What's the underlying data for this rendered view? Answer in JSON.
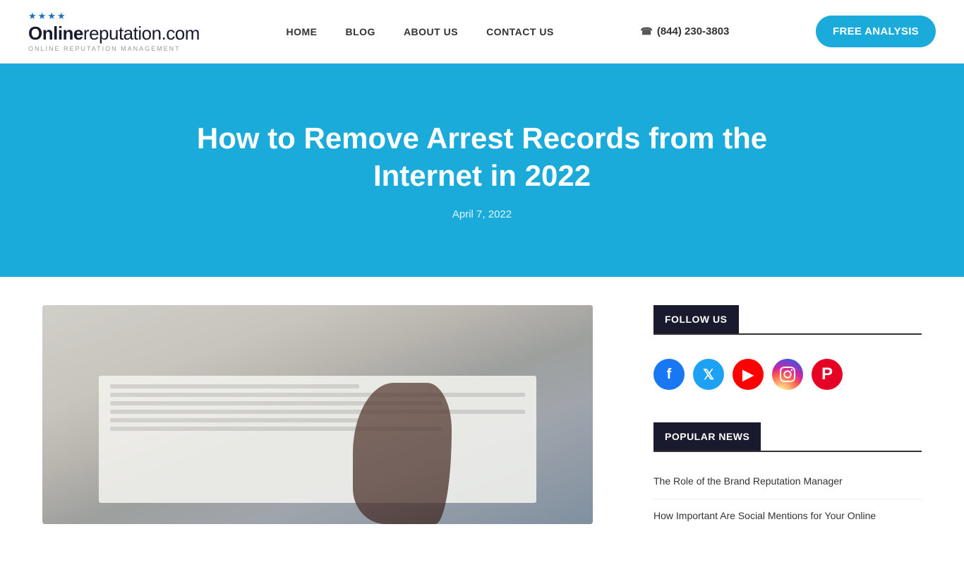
{
  "header": {
    "logo": {
      "online": "Online",
      "reputation": "reputation",
      "dotcom": ".com",
      "tagline": "ONLINE REPUTATION MANAGEMENT",
      "stars": [
        "★",
        "★",
        "★",
        "★"
      ]
    },
    "nav": {
      "items": [
        {
          "label": "HOME",
          "id": "home"
        },
        {
          "label": "BLOG",
          "id": "blog"
        },
        {
          "label": "ABOUT US",
          "id": "about"
        },
        {
          "label": "CONTACT US",
          "id": "contact"
        }
      ],
      "phone": "(844) 230-3803",
      "free_analysis_label": "FREE ANALYSIS"
    }
  },
  "hero": {
    "title": "How to Remove Arrest Records from the Internet in 2022",
    "date": "April 7, 2022"
  },
  "sidebar": {
    "follow_us": {
      "heading": "FOLLOW US",
      "social": [
        {
          "name": "facebook",
          "label": "f",
          "class": "social-facebook"
        },
        {
          "name": "twitter",
          "label": "t",
          "class": "social-twitter"
        },
        {
          "name": "youtube",
          "label": "▶",
          "class": "social-youtube"
        },
        {
          "name": "instagram",
          "label": "📷",
          "class": "social-instagram"
        },
        {
          "name": "pinterest",
          "label": "P",
          "class": "social-pinterest"
        }
      ]
    },
    "popular_news": {
      "heading": "POPULAR NEWS",
      "items": [
        {
          "label": "The Role of the Brand Reputation Manager"
        },
        {
          "label": "How Important Are Social Mentions for Your Online"
        }
      ]
    }
  }
}
